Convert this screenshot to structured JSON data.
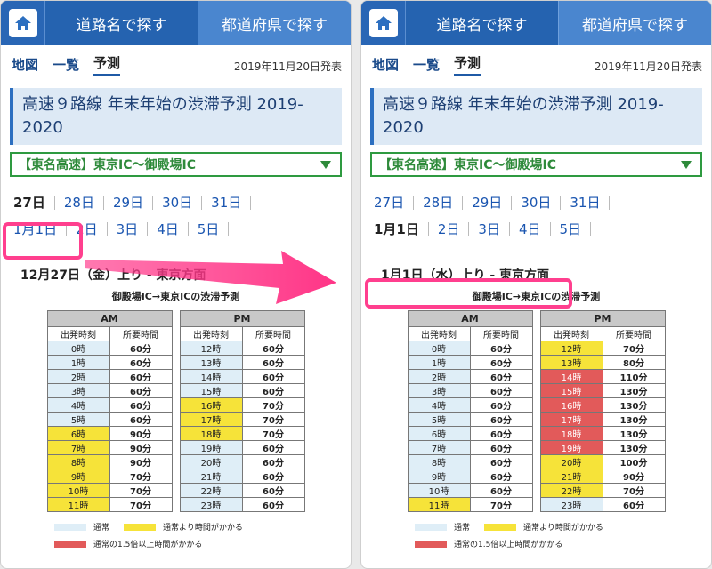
{
  "colors": {
    "normal": "#dfeef7",
    "slow": "#f6e339",
    "heavy": "#e25a5a",
    "highlight": "#ff3f8e"
  },
  "header": {
    "home_icon": "home-icon",
    "tab_road": "道路名で探す",
    "tab_pref": "都道府県で探す"
  },
  "subnav": {
    "map": "地図",
    "list": "一覧",
    "forecast": "予測",
    "announce_date": "2019年11月20日発表"
  },
  "title": "高速９路線 年末年始の渋滞予測 2019-2020",
  "route_select": "【東名高速】東京IC〜御殿場IC",
  "days_row1": [
    "27日",
    "28日",
    "29日",
    "30日",
    "31日"
  ],
  "days_row2": [
    "1月1日",
    "2日",
    "3日",
    "4日",
    "5日"
  ],
  "table_headers": {
    "am": "AM",
    "pm": "PM",
    "dep": "出発時刻",
    "dur": "所要時間"
  },
  "legend": {
    "normal": "通常",
    "slow": "通常より時間がかかる",
    "heavy": "通常の1.5倍以上時間がかかる"
  },
  "screens": [
    {
      "current_day": "27日",
      "section_title": "12月27日（金）上り - 東京方面",
      "section_sub": "御殿場IC→東京ICの渋滞予測",
      "am": [
        {
          "t": "0時",
          "d": "60分",
          "s": "normal"
        },
        {
          "t": "1時",
          "d": "60分",
          "s": "normal"
        },
        {
          "t": "2時",
          "d": "60分",
          "s": "normal"
        },
        {
          "t": "3時",
          "d": "60分",
          "s": "normal"
        },
        {
          "t": "4時",
          "d": "60分",
          "s": "normal"
        },
        {
          "t": "5時",
          "d": "60分",
          "s": "normal"
        },
        {
          "t": "6時",
          "d": "90分",
          "s": "slow"
        },
        {
          "t": "7時",
          "d": "90分",
          "s": "slow"
        },
        {
          "t": "8時",
          "d": "90分",
          "s": "slow"
        },
        {
          "t": "9時",
          "d": "70分",
          "s": "slow"
        },
        {
          "t": "10時",
          "d": "70分",
          "s": "slow"
        },
        {
          "t": "11時",
          "d": "70分",
          "s": "slow"
        }
      ],
      "pm": [
        {
          "t": "12時",
          "d": "60分",
          "s": "normal"
        },
        {
          "t": "13時",
          "d": "60分",
          "s": "normal"
        },
        {
          "t": "14時",
          "d": "60分",
          "s": "normal"
        },
        {
          "t": "15時",
          "d": "60分",
          "s": "normal"
        },
        {
          "t": "16時",
          "d": "70分",
          "s": "slow"
        },
        {
          "t": "17時",
          "d": "70分",
          "s": "slow"
        },
        {
          "t": "18時",
          "d": "70分",
          "s": "slow"
        },
        {
          "t": "19時",
          "d": "60分",
          "s": "normal"
        },
        {
          "t": "20時",
          "d": "60分",
          "s": "normal"
        },
        {
          "t": "21時",
          "d": "60分",
          "s": "normal"
        },
        {
          "t": "22時",
          "d": "60分",
          "s": "normal"
        },
        {
          "t": "23時",
          "d": "60分",
          "s": "normal"
        }
      ]
    },
    {
      "current_day": "1月1日",
      "section_title": "1月1日（水）上り - 東京方面",
      "section_sub": "御殿場IC→東京ICの渋滞予測",
      "am": [
        {
          "t": "0時",
          "d": "60分",
          "s": "normal"
        },
        {
          "t": "1時",
          "d": "60分",
          "s": "normal"
        },
        {
          "t": "2時",
          "d": "60分",
          "s": "normal"
        },
        {
          "t": "3時",
          "d": "60分",
          "s": "normal"
        },
        {
          "t": "4時",
          "d": "60分",
          "s": "normal"
        },
        {
          "t": "5時",
          "d": "60分",
          "s": "normal"
        },
        {
          "t": "6時",
          "d": "60分",
          "s": "normal"
        },
        {
          "t": "7時",
          "d": "60分",
          "s": "normal"
        },
        {
          "t": "8時",
          "d": "60分",
          "s": "normal"
        },
        {
          "t": "9時",
          "d": "60分",
          "s": "normal"
        },
        {
          "t": "10時",
          "d": "60分",
          "s": "normal"
        },
        {
          "t": "11時",
          "d": "70分",
          "s": "slow"
        }
      ],
      "pm": [
        {
          "t": "12時",
          "d": "70分",
          "s": "slow"
        },
        {
          "t": "13時",
          "d": "80分",
          "s": "slow"
        },
        {
          "t": "14時",
          "d": "110分",
          "s": "heavy"
        },
        {
          "t": "15時",
          "d": "130分",
          "s": "heavy"
        },
        {
          "t": "16時",
          "d": "130分",
          "s": "heavy"
        },
        {
          "t": "17時",
          "d": "130分",
          "s": "heavy"
        },
        {
          "t": "18時",
          "d": "130分",
          "s": "heavy"
        },
        {
          "t": "19時",
          "d": "130分",
          "s": "heavy"
        },
        {
          "t": "20時",
          "d": "100分",
          "s": "slow"
        },
        {
          "t": "21時",
          "d": "90分",
          "s": "slow"
        },
        {
          "t": "22時",
          "d": "70分",
          "s": "slow"
        },
        {
          "t": "23時",
          "d": "60分",
          "s": "normal"
        }
      ]
    }
  ]
}
